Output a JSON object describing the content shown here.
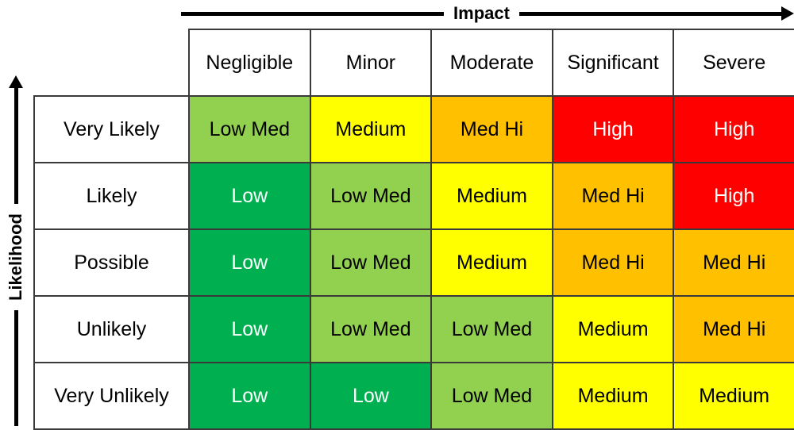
{
  "axes": {
    "x_label": "Impact",
    "y_label": "Likelihood",
    "x_arrow_icon": "arrow-right-icon",
    "y_arrow_icon": "arrow-up-icon"
  },
  "colors": {
    "low": "#00B050",
    "low_med": "#92D050",
    "medium": "#FFFF00",
    "med_hi": "#FFC000",
    "high": "#FF0000",
    "header_background": "#FFFFFF",
    "border": "#3A3A3A",
    "text_dark": "#000000",
    "text_light": "#FFFFFF"
  },
  "chart_data": {
    "type": "heatmap",
    "title": "",
    "xlabel": "Impact",
    "ylabel": "Likelihood",
    "grid": true,
    "legend_position": "none",
    "categories_x": [
      "Negligible",
      "Minor",
      "Moderate",
      "Significant",
      "Severe"
    ],
    "categories_y": [
      "Very Likely",
      "Likely",
      "Possible",
      "Unlikely",
      "Very Unlikely"
    ],
    "rows": [
      {
        "label": "Very Likely",
        "cells": [
          {
            "label": "Low Med",
            "color": "#92D050",
            "text_color": "#000000",
            "level": 2
          },
          {
            "label": "Medium",
            "color": "#FFFF00",
            "text_color": "#000000",
            "level": 3
          },
          {
            "label": "Med Hi",
            "color": "#FFC000",
            "text_color": "#000000",
            "level": 4
          },
          {
            "label": "High",
            "color": "#FF0000",
            "text_color": "#FFFFFF",
            "level": 5
          },
          {
            "label": "High",
            "color": "#FF0000",
            "text_color": "#FFFFFF",
            "level": 5
          }
        ]
      },
      {
        "label": "Likely",
        "cells": [
          {
            "label": "Low",
            "color": "#00B050",
            "text_color": "#FFFFFF",
            "level": 1
          },
          {
            "label": "Low Med",
            "color": "#92D050",
            "text_color": "#000000",
            "level": 2
          },
          {
            "label": "Medium",
            "color": "#FFFF00",
            "text_color": "#000000",
            "level": 3
          },
          {
            "label": "Med Hi",
            "color": "#FFC000",
            "text_color": "#000000",
            "level": 4
          },
          {
            "label": "High",
            "color": "#FF0000",
            "text_color": "#FFFFFF",
            "level": 5
          }
        ]
      },
      {
        "label": "Possible",
        "cells": [
          {
            "label": "Low",
            "color": "#00B050",
            "text_color": "#FFFFFF",
            "level": 1
          },
          {
            "label": "Low Med",
            "color": "#92D050",
            "text_color": "#000000",
            "level": 2
          },
          {
            "label": "Medium",
            "color": "#FFFF00",
            "text_color": "#000000",
            "level": 3
          },
          {
            "label": "Med Hi",
            "color": "#FFC000",
            "text_color": "#000000",
            "level": 4
          },
          {
            "label": "Med Hi",
            "color": "#FFC000",
            "text_color": "#000000",
            "level": 4
          }
        ]
      },
      {
        "label": "Unlikely",
        "cells": [
          {
            "label": "Low",
            "color": "#00B050",
            "text_color": "#FFFFFF",
            "level": 1
          },
          {
            "label": "Low Med",
            "color": "#92D050",
            "text_color": "#000000",
            "level": 2
          },
          {
            "label": "Low Med",
            "color": "#92D050",
            "text_color": "#000000",
            "level": 2
          },
          {
            "label": "Medium",
            "color": "#FFFF00",
            "text_color": "#000000",
            "level": 3
          },
          {
            "label": "Med Hi",
            "color": "#FFC000",
            "text_color": "#000000",
            "level": 4
          }
        ]
      },
      {
        "label": "Very Unlikely",
        "cells": [
          {
            "label": "Low",
            "color": "#00B050",
            "text_color": "#FFFFFF",
            "level": 1
          },
          {
            "label": "Low",
            "color": "#00B050",
            "text_color": "#FFFFFF",
            "level": 1
          },
          {
            "label": "Low Med",
            "color": "#92D050",
            "text_color": "#000000",
            "level": 2
          },
          {
            "label": "Medium",
            "color": "#FFFF00",
            "text_color": "#000000",
            "level": 3
          },
          {
            "label": "Medium",
            "color": "#FFFF00",
            "text_color": "#000000",
            "level": 3
          }
        ]
      }
    ]
  }
}
